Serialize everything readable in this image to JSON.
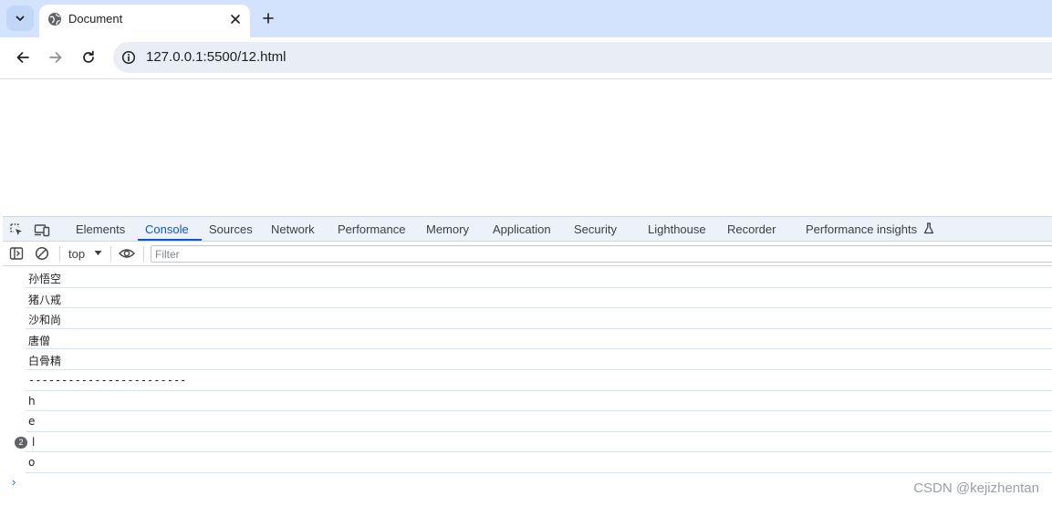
{
  "browser": {
    "tab_title": "Document",
    "url": "127.0.0.1:5500/12.html",
    "icons": {
      "tab_search": "chevron-down-icon",
      "favicon": "globe-icon",
      "tab_close": "close-icon",
      "new_tab": "plus-icon",
      "back": "arrow-left-icon",
      "forward": "arrow-right-icon",
      "reload": "reload-icon",
      "site_info": "info-icon"
    }
  },
  "devtools": {
    "tabs": [
      {
        "label": "Elements"
      },
      {
        "label": "Console",
        "active": true
      },
      {
        "label": "Sources"
      },
      {
        "label": "Network"
      },
      {
        "label": "Performance"
      },
      {
        "label": "Memory"
      },
      {
        "label": "Application"
      },
      {
        "label": "Security"
      },
      {
        "label": "Lighthouse"
      },
      {
        "label": "Recorder"
      },
      {
        "label": "Performance insights"
      }
    ],
    "console": {
      "context": "top",
      "filter_placeholder": "Filter",
      "messages": [
        {
          "text": "孙悟空"
        },
        {
          "text": "猪八戒"
        },
        {
          "text": "沙和尚"
        },
        {
          "text": "唐僧"
        },
        {
          "text": "白骨精"
        },
        {
          "text": "------------------------"
        },
        {
          "text": "h"
        },
        {
          "text": "e"
        },
        {
          "text": "l",
          "repeat": "2"
        },
        {
          "text": "o"
        }
      ],
      "prompt_glyph": "›"
    }
  },
  "watermark": "CSDN @kejizhentan",
  "colors": {
    "accent": "#0b57d0",
    "tabstrip": "#d3e3fd",
    "omnibox": "#e9eef6",
    "devtools_tabbar": "#edf2fa"
  }
}
